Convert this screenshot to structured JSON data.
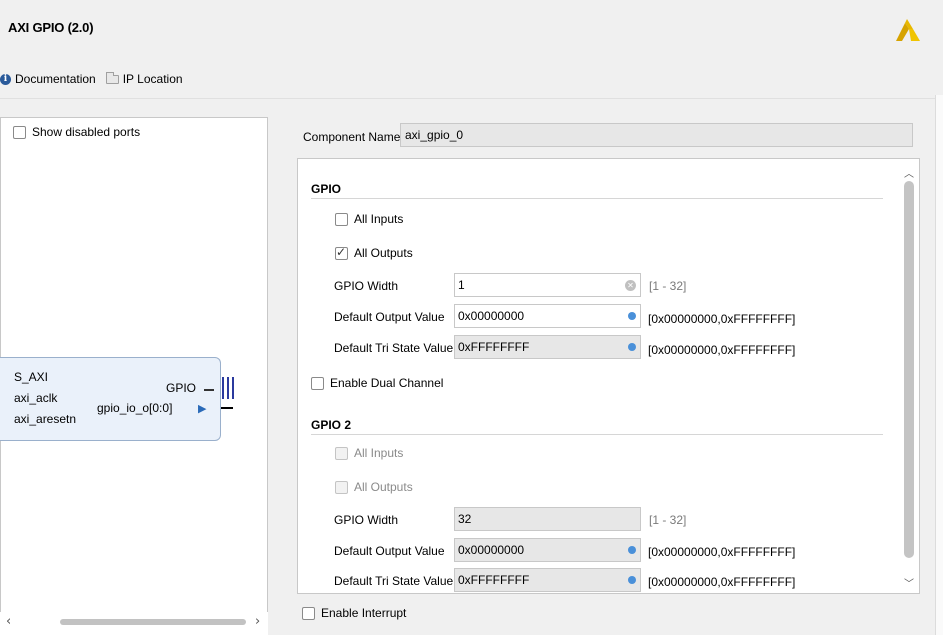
{
  "header": {
    "title": "AXI GPIO (2.0)",
    "links": [
      {
        "label": "Documentation",
        "icon": "info-icon"
      },
      {
        "label": "IP Location",
        "icon": "folder-icon"
      }
    ],
    "logo_color": "#e8b800"
  },
  "left_panel": {
    "show_disabled_ports": {
      "label": "Show disabled ports",
      "checked": false
    },
    "ip_block": {
      "left_ports": [
        "S_AXI",
        "axi_aclk",
        "axi_aresetn"
      ],
      "right_ports": [
        "GPIO",
        "gpio_io_o[0:0]"
      ]
    }
  },
  "right_panel": {
    "component_name_label": "Component Name",
    "component_name_value": "axi_gpio_0",
    "gpio": {
      "title": "GPIO",
      "all_inputs": {
        "label": "All Inputs",
        "checked": false
      },
      "all_outputs": {
        "label": "All Outputs",
        "checked": true
      },
      "width_label": "GPIO Width",
      "width_value": "1",
      "width_range": "[1 - 32]",
      "default_output_label": "Default Output Value",
      "default_output_value": "0x00000000",
      "default_output_range": "[0x00000000,0xFFFFFFFF]",
      "default_tri_label": "Default Tri State Value",
      "default_tri_value": "0xFFFFFFFF",
      "default_tri_range": "[0x00000000,0xFFFFFFFF]"
    },
    "enable_dual_channel": {
      "label": "Enable Dual Channel",
      "checked": false
    },
    "gpio2": {
      "title": "GPIO 2",
      "all_inputs": {
        "label": "All Inputs",
        "checked": false
      },
      "all_outputs": {
        "label": "All Outputs",
        "checked": false
      },
      "width_label": "GPIO Width",
      "width_value": "32",
      "width_range": "[1 - 32]",
      "default_output_label": "Default Output Value",
      "default_output_value": "0x00000000",
      "default_output_range": "[0x00000000,0xFFFFFFFF]",
      "default_tri_label": "Default Tri State Value",
      "default_tri_value": "0xFFFFFFFF",
      "default_tri_range": "[0x00000000,0xFFFFFFFF]"
    },
    "enable_interrupt": {
      "label": "Enable Interrupt",
      "checked": false
    }
  }
}
